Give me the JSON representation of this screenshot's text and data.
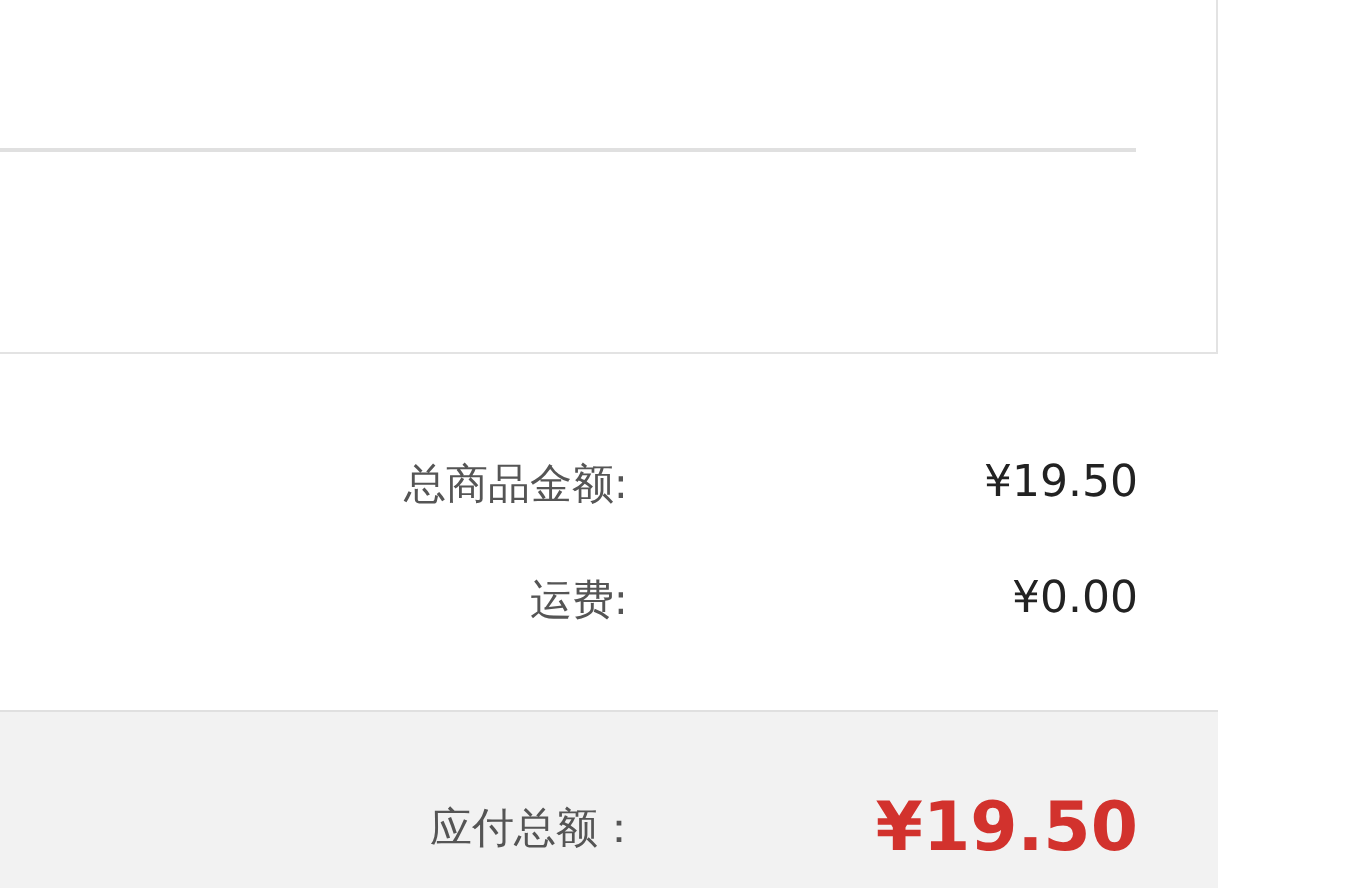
{
  "summary": [
    {
      "label": "总商品金额:",
      "value": "¥19.50"
    },
    {
      "label": "运费:",
      "value": "¥0.00"
    }
  ],
  "total": {
    "label": "应付总额：",
    "value": "¥19.50"
  }
}
